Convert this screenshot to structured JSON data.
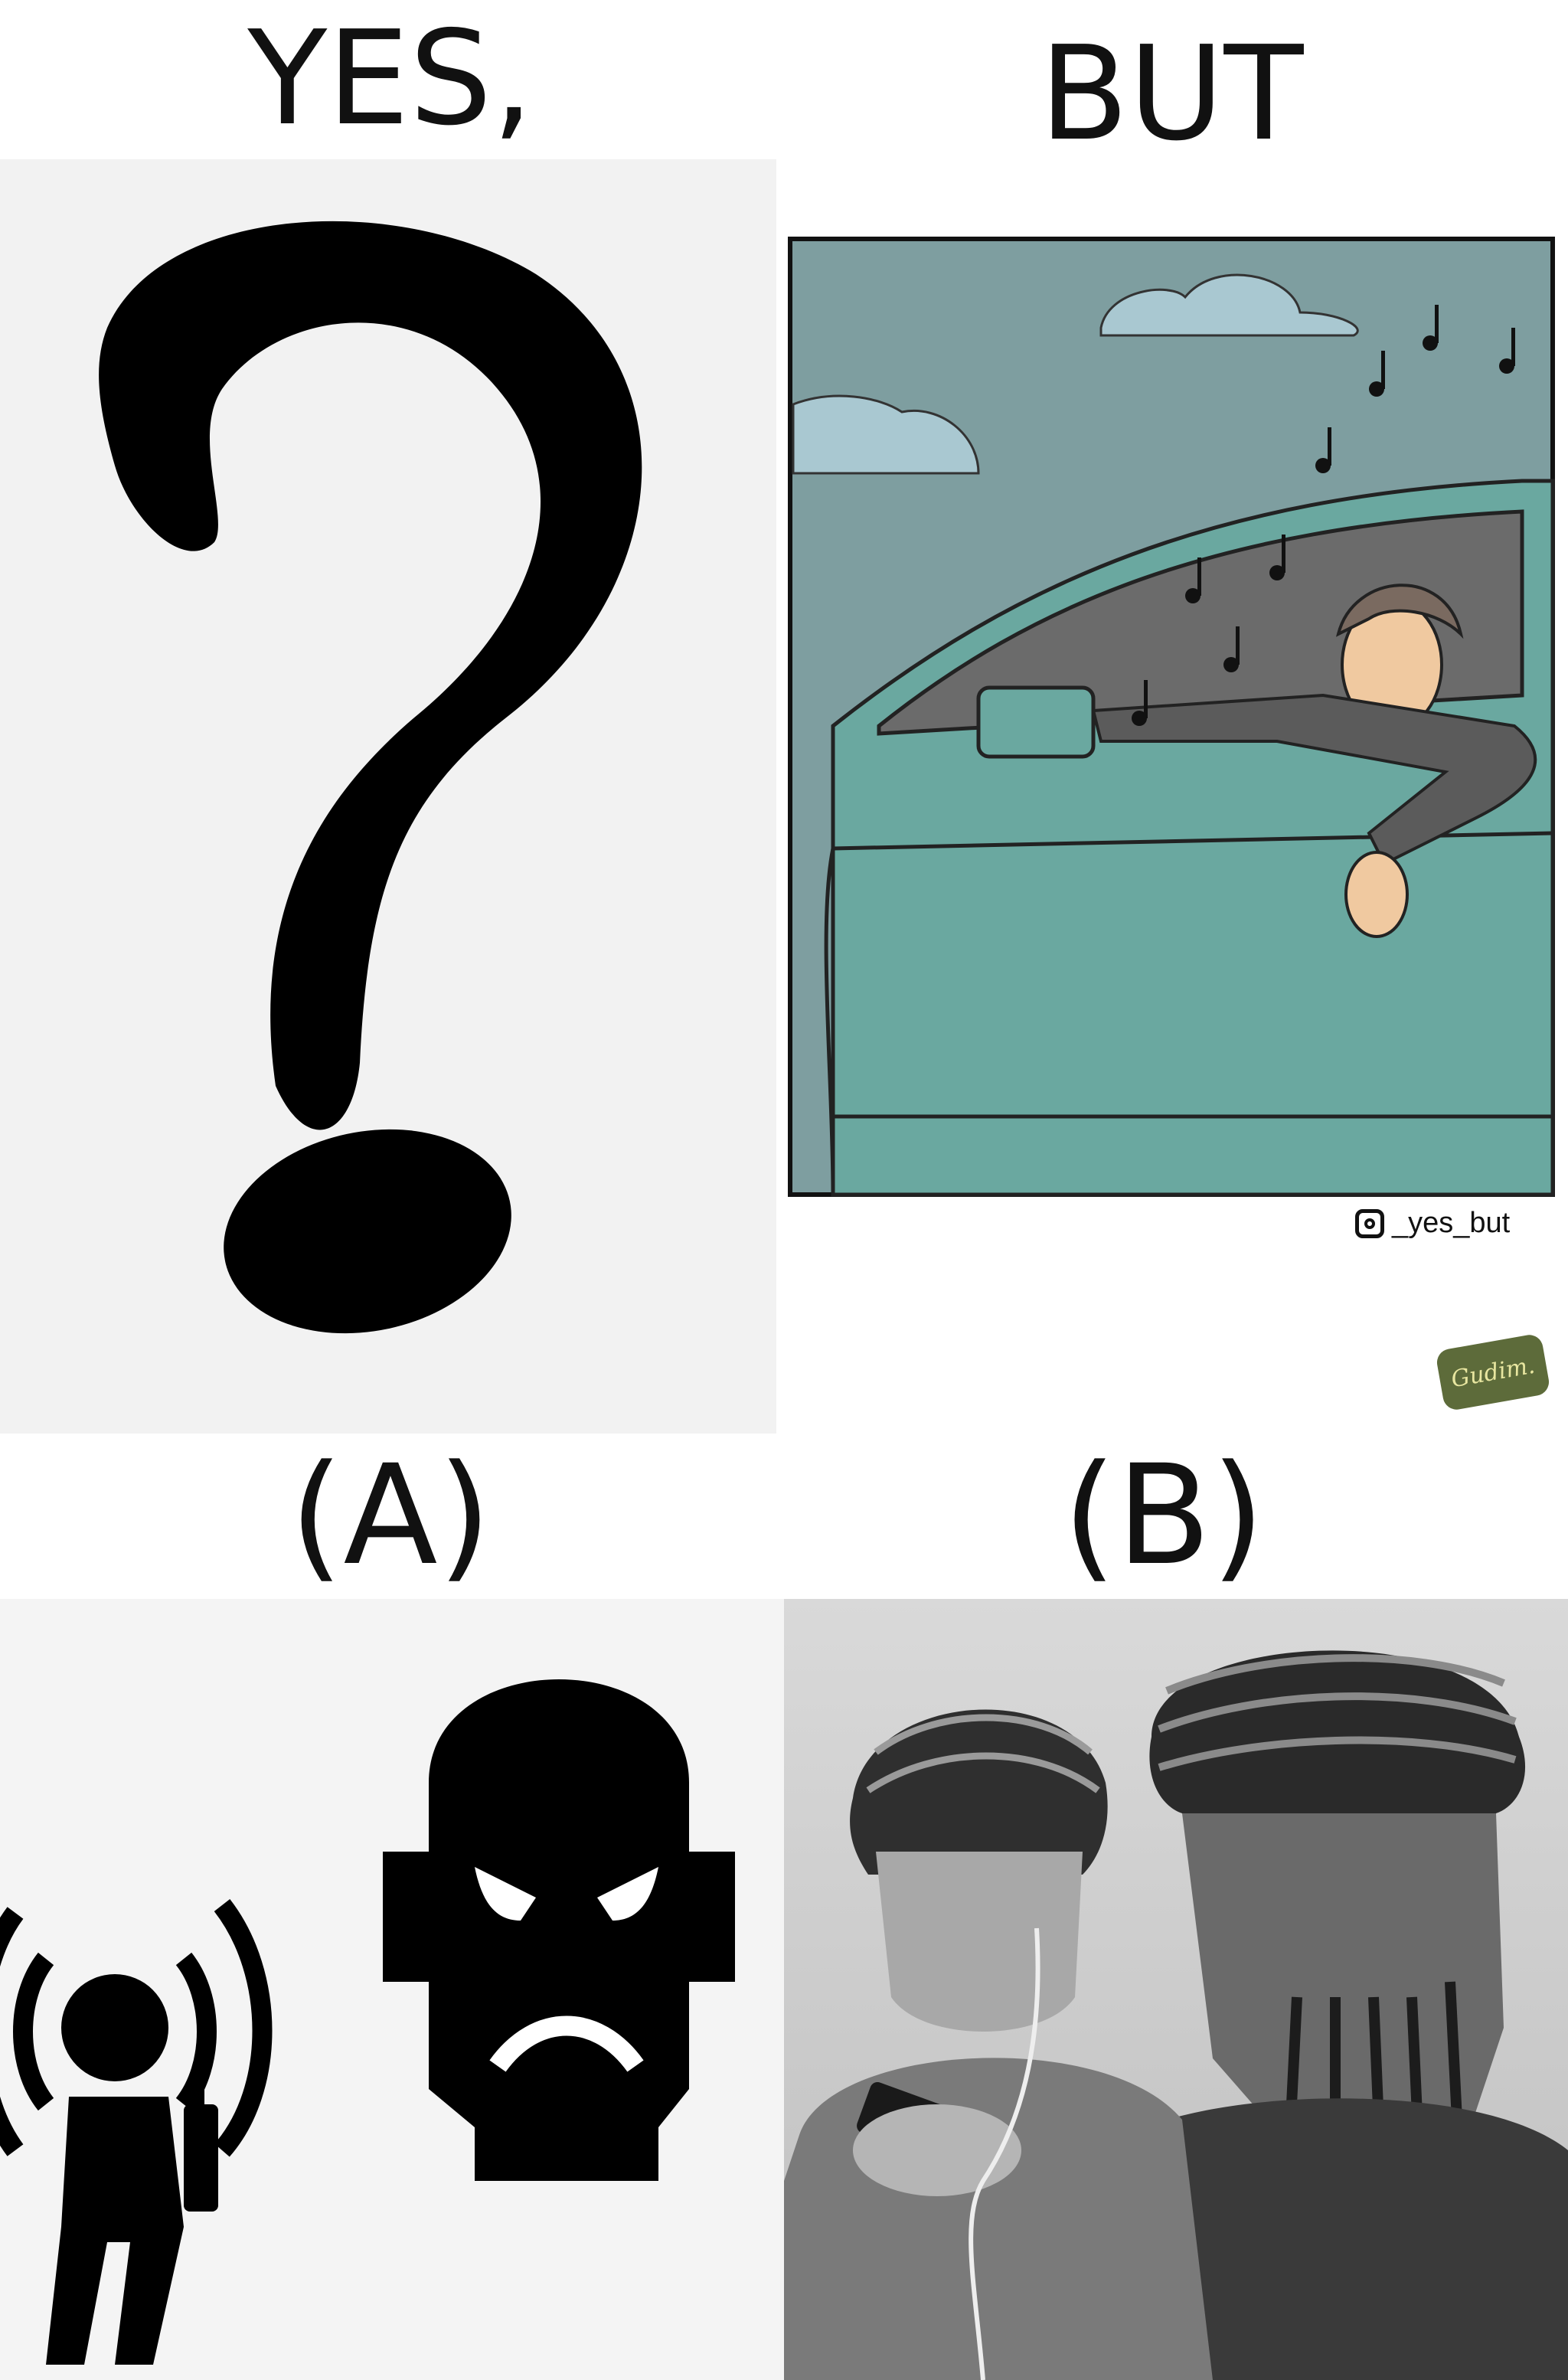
{
  "headings": {
    "yes": "YES,",
    "but": "BUT",
    "label_a": "(A)",
    "label_b": "(B)"
  },
  "panel_top_right": {
    "credit_handle": "_yes_but",
    "credit_icon": "instagram-icon",
    "signature": "Gudim."
  },
  "colors": {
    "car_body": "#6aa8a0",
    "sky": "#7e9ea0",
    "cloud": "#a9c8d1",
    "skin": "#f0c9a0",
    "shirt": "#5b5b5b"
  }
}
